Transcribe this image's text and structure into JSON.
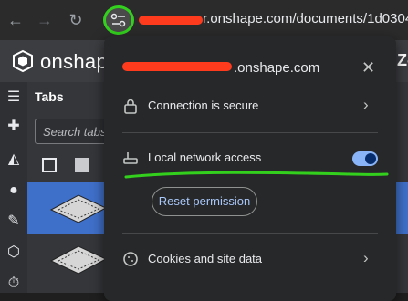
{
  "browser": {
    "back_icon": "arrow-left-icon",
    "forward_icon": "arrow-right-icon",
    "reload_icon": "reload-icon",
    "site_info_icon": "tune-icon",
    "url_visible": "r.onshape.com/documents/1d0304"
  },
  "app": {
    "logo_text": "onshape",
    "header_right_text": "Z-"
  },
  "tabs_panel": {
    "title": "Tabs",
    "search_placeholder": "Search tabs"
  },
  "popup": {
    "domain_visible": ".onshape.com",
    "connection_label": "Connection is secure",
    "local_network_label": "Local network access",
    "local_network_enabled": true,
    "reset_label": "Reset permission",
    "cookies_label": "Cookies and site data"
  },
  "colors": {
    "highlight_green": "#33d11e",
    "redaction_red": "#ff3b1e",
    "selected_tab": "#3f70c9",
    "toggle_on": "#8ab4f8"
  }
}
